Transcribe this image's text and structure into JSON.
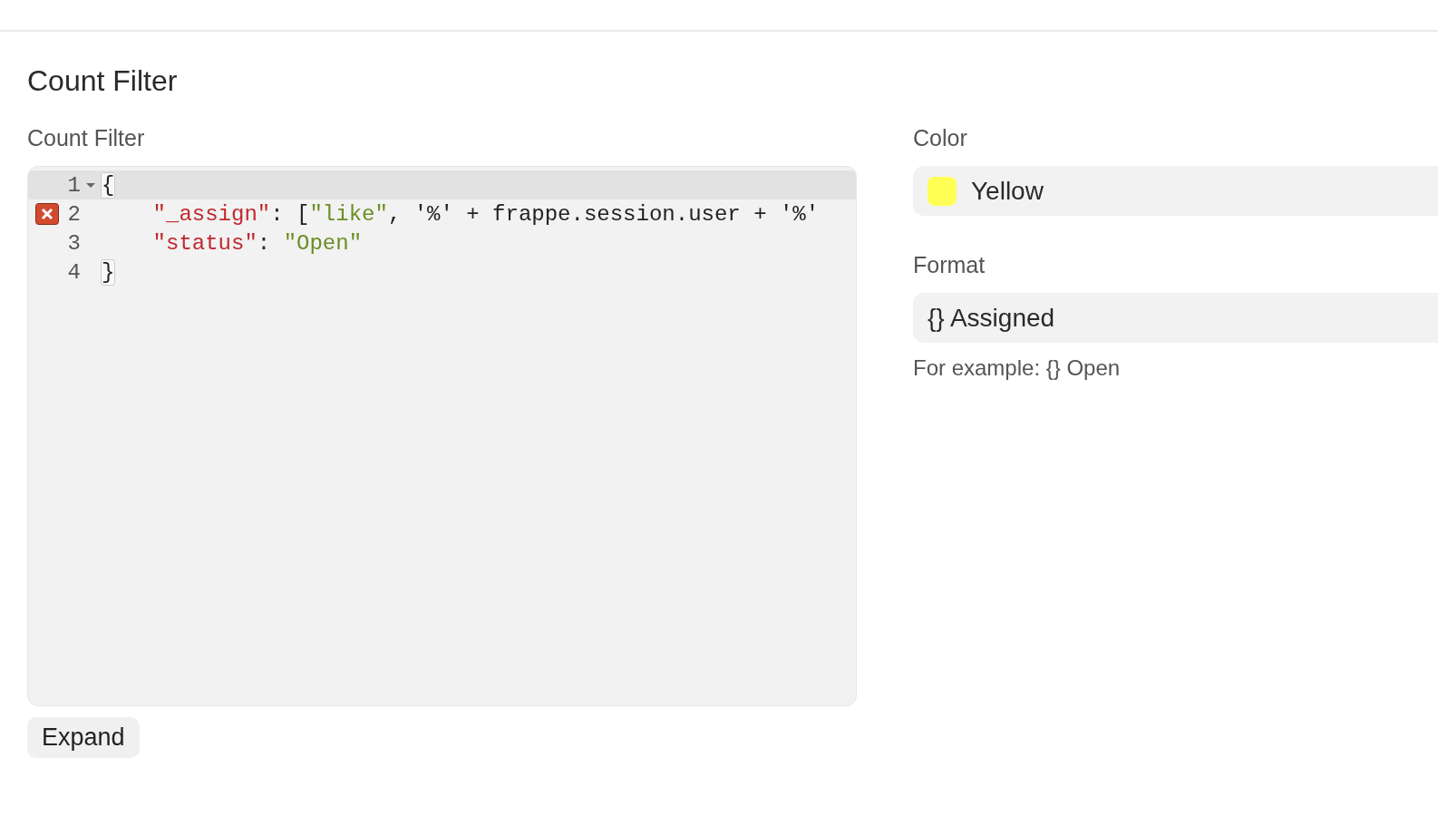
{
  "section_title": "Count Filter",
  "count_filter": {
    "label": "Count Filter",
    "lines": [
      {
        "number": "1",
        "active": true,
        "foldable": true,
        "error": false,
        "tokens": [
          {
            "kind": "bracket",
            "text": "{"
          }
        ]
      },
      {
        "number": "2",
        "active": false,
        "foldable": false,
        "error": true,
        "tokens": [
          {
            "kind": "key",
            "text": "    \"_assign\""
          },
          {
            "kind": "plain",
            "text": ": ["
          },
          {
            "kind": "string",
            "text": "\"like\""
          },
          {
            "kind": "plain",
            "text": ", '%' + frappe.session.user + '%'"
          }
        ]
      },
      {
        "number": "3",
        "active": false,
        "foldable": false,
        "error": false,
        "tokens": [
          {
            "kind": "key",
            "text": "    \"status\""
          },
          {
            "kind": "plain",
            "text": ": "
          },
          {
            "kind": "string",
            "text": "\"Open\""
          }
        ]
      },
      {
        "number": "4",
        "active": false,
        "foldable": false,
        "error": false,
        "tokens": [
          {
            "kind": "bracket",
            "text": "}"
          }
        ]
      }
    ],
    "expand_button": "Expand"
  },
  "color": {
    "label": "Color",
    "value": "Yellow",
    "color": "#ffff55"
  },
  "format": {
    "label": "Format",
    "value": "{} Assigned",
    "hint": "For example: {} Open"
  }
}
